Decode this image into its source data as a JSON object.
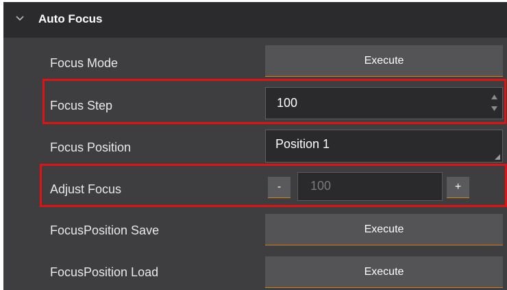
{
  "section": {
    "title": "Auto Focus",
    "expanded": true
  },
  "rows": {
    "focus_mode": {
      "label": "Focus Mode",
      "button": "Execute"
    },
    "focus_step": {
      "label": "Focus Step",
      "value": "100"
    },
    "focus_position": {
      "label": "Focus Position",
      "value": "Position 1"
    },
    "adjust_focus": {
      "label": "Adjust Focus",
      "minus": "-",
      "value": "100",
      "plus": "+"
    },
    "focus_position_save": {
      "label": "FocusPosition Save",
      "button": "Execute"
    },
    "focus_position_load": {
      "label": "FocusPosition Load",
      "button": "Execute"
    }
  },
  "colors": {
    "panel_bg": "#3e3e40",
    "header_bg": "#2b2b2d",
    "button_bg": "#545456",
    "button_accent": "#d67e1a",
    "highlight": "#e01212"
  },
  "icons": {
    "collapse": "chevron-down-icon",
    "spin_up": "caret-up-icon",
    "spin_down": "caret-down-icon",
    "combo": "resize-grip-icon"
  }
}
